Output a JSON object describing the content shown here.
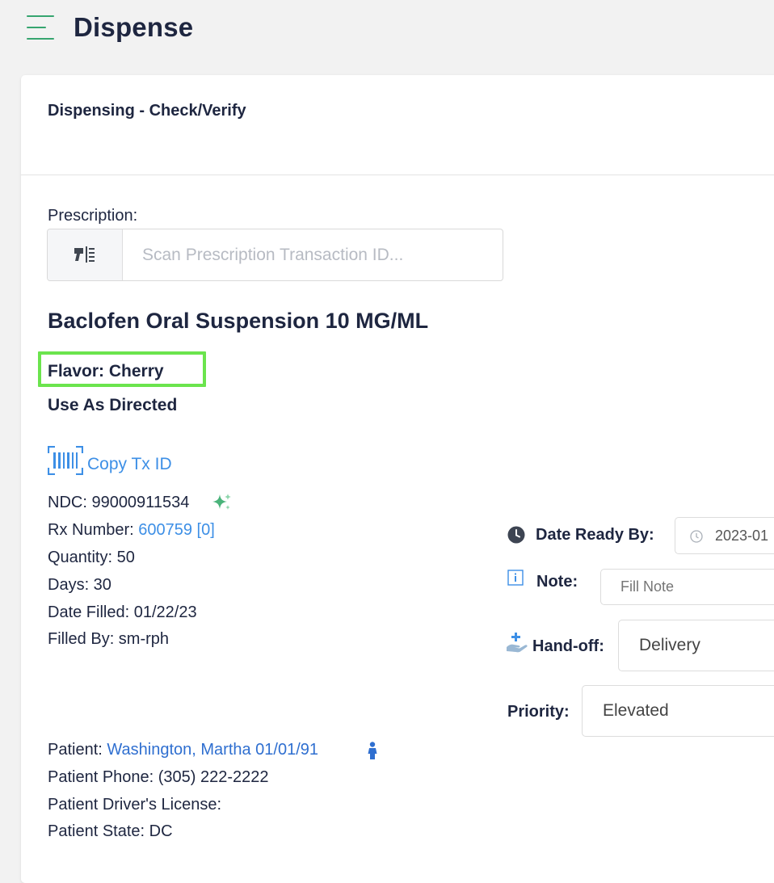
{
  "header": {
    "title": "Dispense"
  },
  "card": {
    "title": "Dispensing - Check/Verify"
  },
  "prescription": {
    "label": "Prescription:",
    "placeholder": "Scan Prescription Transaction ID..."
  },
  "drug": {
    "name": "Baclofen Oral Suspension 10 MG/ML",
    "flavor": "Flavor: Cherry",
    "directions": "Use As Directed",
    "highlight_color": "#6be44d"
  },
  "copy_tx": {
    "label": "Copy Tx ID"
  },
  "details": {
    "ndc": "NDC: 99000911534",
    "rx_label": "Rx Number: ",
    "rx_value": "600759 [0]",
    "quantity": "Quantity: 50",
    "days": "Days: 30",
    "date_filled": "Date Filled: 01/22/23",
    "filled_by": "Filled By: sm-rph"
  },
  "patient": {
    "label": "Patient: ",
    "name": "Washington, Martha 01/01/91",
    "phone": "Patient Phone: (305) 222-2222",
    "license": "Patient Driver's License:",
    "state": "Patient State: DC"
  },
  "side": {
    "date_ready_label": "Date Ready By:",
    "date_ready_value": "2023-01",
    "note_label": "Note:",
    "note_placeholder": "Fill Note",
    "handoff_label": "Hand-off:",
    "handoff_value": "Delivery",
    "priority_label": "Priority:",
    "priority_value": "Elevated"
  },
  "icons": {
    "menu": "hamburger-menu-icon",
    "scanner": "barcode-scanner-icon",
    "barcode": "barcode-icon",
    "sparkle": "sparkle-icon",
    "person": "person-icon",
    "clock": "clock-icon",
    "info": "info-icon",
    "handoff": "hand-with-plus-icon"
  },
  "colors": {
    "brand_green": "#36a56f",
    "link_blue": "#3d8fe6",
    "text_dark": "#1e2640"
  }
}
